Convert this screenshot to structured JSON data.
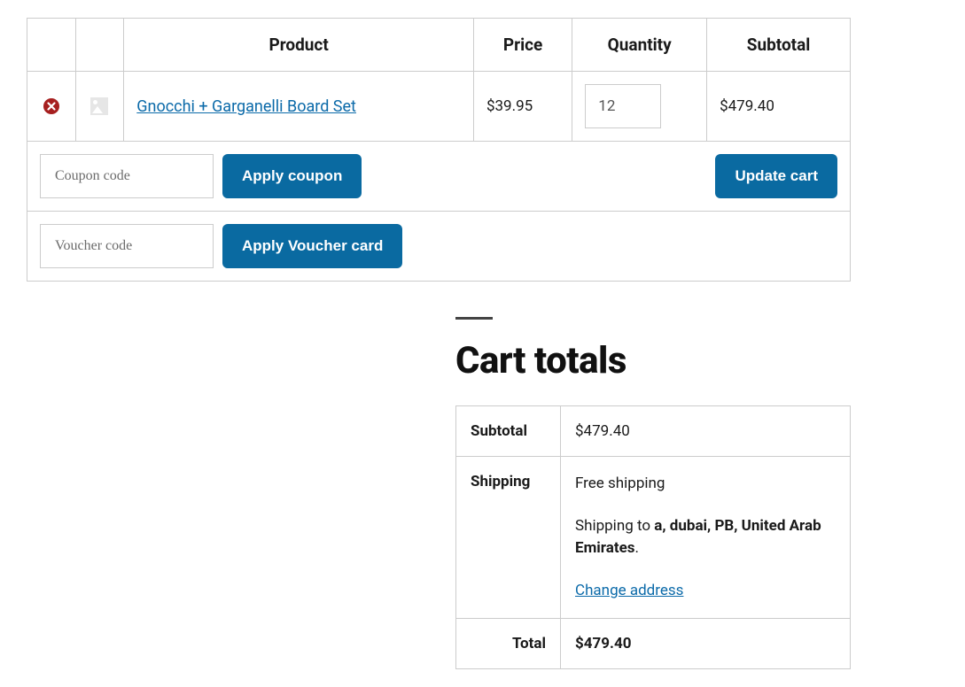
{
  "cart": {
    "headers": {
      "product": "Product",
      "price": "Price",
      "quantity": "Quantity",
      "subtotal": "Subtotal"
    },
    "item": {
      "name": "Gnocchi + Garganelli Board Set",
      "price": "$39.95",
      "quantity": "12",
      "subtotal": "$479.40"
    },
    "coupon": {
      "placeholder": "Coupon code",
      "apply_label": "Apply coupon"
    },
    "voucher": {
      "placeholder": "Voucher code",
      "apply_label": "Apply Voucher card"
    },
    "update_label": "Update cart"
  },
  "totals": {
    "heading": "Cart totals",
    "subtotal_label": "Subtotal",
    "subtotal_value": "$479.40",
    "shipping_label": "Shipping",
    "shipping_method": "Free shipping",
    "shipping_to_prefix": "Shipping to ",
    "shipping_destination": "a, dubai, PB, United Arab Emirates",
    "shipping_to_suffix": ".",
    "change_address": "Change address",
    "total_label": "Total",
    "total_value": "$479.40"
  }
}
